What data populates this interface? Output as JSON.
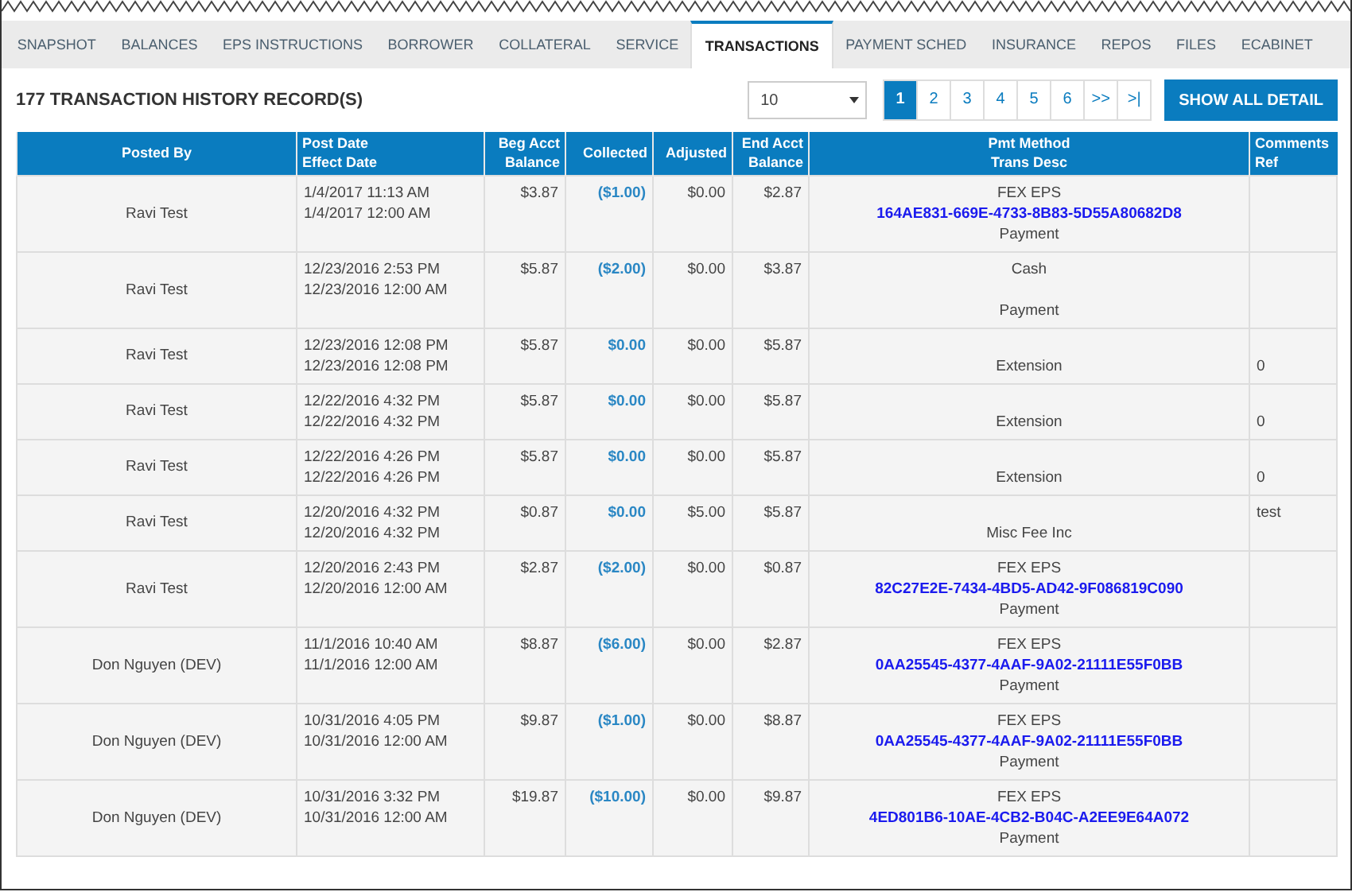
{
  "tabs": [
    {
      "label": "SNAPSHOT",
      "selected": false
    },
    {
      "label": "BALANCES",
      "selected": false
    },
    {
      "label": "EPS INSTRUCTIONS",
      "selected": false
    },
    {
      "label": "BORROWER",
      "selected": false
    },
    {
      "label": "COLLATERAL",
      "selected": false
    },
    {
      "label": "SERVICE",
      "selected": false
    },
    {
      "label": "TRANSACTIONS",
      "selected": true
    },
    {
      "label": "PAYMENT SCHED",
      "selected": false
    },
    {
      "label": "INSURANCE",
      "selected": false
    },
    {
      "label": "REPOS",
      "selected": false
    },
    {
      "label": "FILES",
      "selected": false
    },
    {
      "label": "ECABINET",
      "selected": false
    }
  ],
  "records_title": "177 TRANSACTION HISTORY RECORD(S)",
  "page_size": {
    "value": "10"
  },
  "pagination": [
    {
      "label": "1",
      "selected": true
    },
    {
      "label": "2",
      "selected": false
    },
    {
      "label": "3",
      "selected": false
    },
    {
      "label": "4",
      "selected": false
    },
    {
      "label": "5",
      "selected": false
    },
    {
      "label": "6",
      "selected": false
    },
    {
      "label": ">>",
      "selected": false
    },
    {
      "label": ">|",
      "selected": false
    }
  ],
  "show_all_button": "SHOW ALL DETAIL",
  "table": {
    "columns": [
      [
        "Posted By"
      ],
      [
        "Post Date",
        "Effect Date"
      ],
      [
        "Beg Acct",
        "Balance"
      ],
      [
        "Collected"
      ],
      [
        "Adjusted"
      ],
      [
        "End Acct",
        "Balance"
      ],
      [
        "Pmt Method",
        "Trans Desc"
      ],
      [
        "Comments",
        "Ref"
      ]
    ],
    "rows": [
      {
        "posted_by": "Ravi Test",
        "post_date": "1/4/2017 11:13 AM",
        "effect_date": "1/4/2017 12:00 AM",
        "beg": "$3.87",
        "collected": "($1.00)",
        "adjusted": "$0.00",
        "end": "$2.87",
        "method": "FEX EPS",
        "ref": "164AE831-669E-4733-8B83-5D55A80682D8",
        "desc": "Payment"
      },
      {
        "posted_by": "Ravi Test",
        "post_date": "12/23/2016 2:53 PM",
        "effect_date": "12/23/2016 12:00 AM",
        "beg": "$5.87",
        "collected": "($2.00)",
        "adjusted": "$0.00",
        "end": "$3.87",
        "method": "Cash",
        "desc": "Payment"
      },
      {
        "posted_by": "Ravi Test",
        "post_date": "12/23/2016 12:08 PM",
        "effect_date": "12/23/2016 12:08 PM",
        "beg": "$5.87",
        "collected": "$0.00",
        "adjusted": "$0.00",
        "end": "$5.87",
        "desc": "Extension",
        "comments": "0"
      },
      {
        "posted_by": "Ravi Test",
        "post_date": "12/22/2016 4:32 PM",
        "effect_date": "12/22/2016 4:32 PM",
        "beg": "$5.87",
        "collected": "$0.00",
        "adjusted": "$0.00",
        "end": "$5.87",
        "desc": "Extension",
        "comments": "0"
      },
      {
        "posted_by": "Ravi Test",
        "post_date": "12/22/2016 4:26 PM",
        "effect_date": "12/22/2016 4:26 PM",
        "beg": "$5.87",
        "collected": "$0.00",
        "adjusted": "$0.00",
        "end": "$5.87",
        "desc": "Extension",
        "comments": "0"
      },
      {
        "posted_by": "Ravi Test",
        "post_date": "12/20/2016 4:32 PM",
        "effect_date": "12/20/2016 4:32 PM",
        "beg": "$0.87",
        "collected": "$0.00",
        "adjusted": "$5.00",
        "end": "$5.87",
        "desc": "Misc Fee Inc",
        "comments": "test"
      },
      {
        "posted_by": "Ravi Test",
        "post_date": "12/20/2016 2:43 PM",
        "effect_date": "12/20/2016 12:00 AM",
        "beg": "$2.87",
        "collected": "($2.00)",
        "adjusted": "$0.00",
        "end": "$0.87",
        "method": "FEX EPS",
        "ref": "82C27E2E-7434-4BD5-AD42-9F086819C090",
        "desc": "Payment"
      },
      {
        "posted_by": "Don Nguyen (DEV)",
        "post_date": "11/1/2016 10:40 AM",
        "effect_date": "11/1/2016 12:00 AM",
        "beg": "$8.87",
        "collected": "($6.00)",
        "adjusted": "$0.00",
        "end": "$2.87",
        "method": "FEX EPS",
        "ref": "0AA25545-4377-4AAF-9A02-21111E55F0BB",
        "desc": "Payment"
      },
      {
        "posted_by": "Don Nguyen (DEV)",
        "post_date": "10/31/2016 4:05 PM",
        "effect_date": "10/31/2016 12:00 AM",
        "beg": "$9.87",
        "collected": "($1.00)",
        "adjusted": "$0.00",
        "end": "$8.87",
        "method": "FEX EPS",
        "ref": "0AA25545-4377-4AAF-9A02-21111E55F0BB",
        "desc": "Payment"
      },
      {
        "posted_by": "Don Nguyen (DEV)",
        "post_date": "10/31/2016 3:32 PM",
        "effect_date": "10/31/2016 12:00 AM",
        "beg": "$19.87",
        "collected": "($10.00)",
        "adjusted": "$0.00",
        "end": "$9.87",
        "method": "FEX EPS",
        "ref": "4ED801B6-10AE-4CB2-B04C-A2EE9E64A072",
        "desc": "Payment"
      }
    ]
  }
}
